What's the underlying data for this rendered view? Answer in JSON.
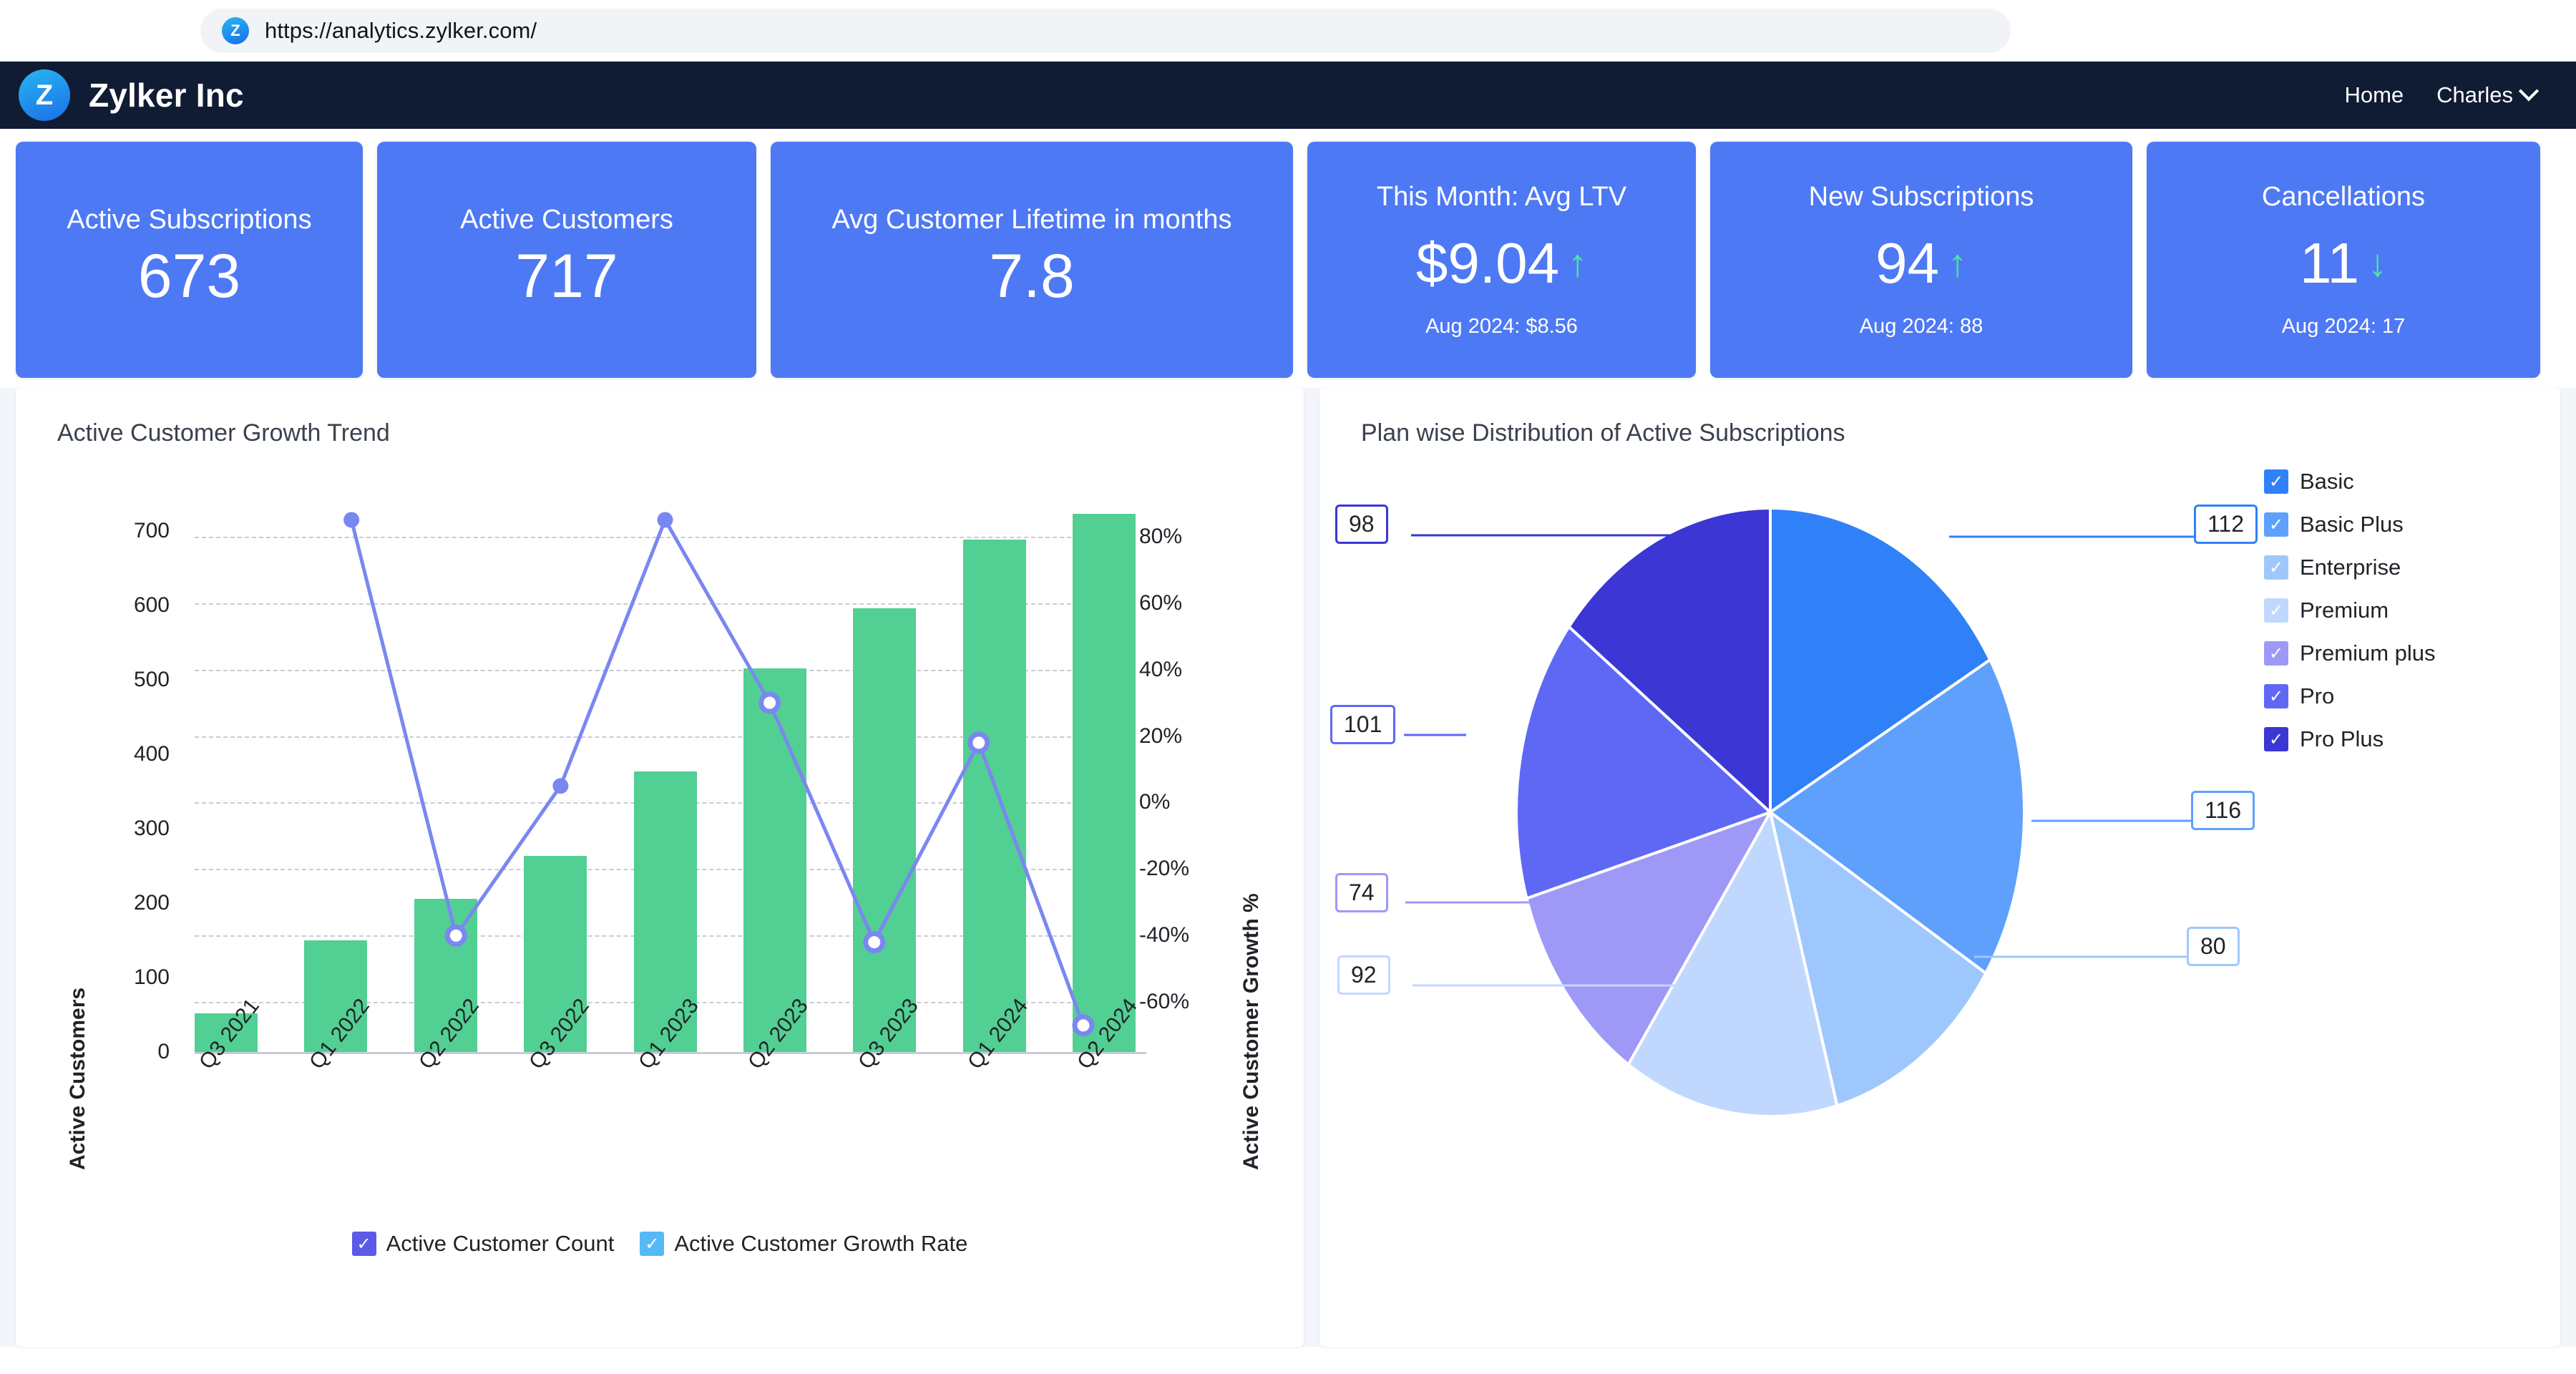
{
  "browser": {
    "url": "https://analytics.zylker.com/",
    "favicon_letter": "Z",
    "favicon_name": "zylker-favicon"
  },
  "header": {
    "logo_letter": "Z",
    "brand": "Zylker Inc",
    "nav": [
      {
        "label": "Home",
        "name": "nav-home"
      },
      {
        "label": "Charles",
        "name": "nav-user"
      }
    ]
  },
  "kpis": [
    {
      "label": "Active Subscriptions",
      "value": "673",
      "sub": "",
      "trend": ""
    },
    {
      "label": "Active Customers",
      "value": "717",
      "sub": "",
      "trend": ""
    },
    {
      "label": "Avg Customer Lifetime in months",
      "value": "7.8",
      "sub": "",
      "trend": ""
    },
    {
      "label": "This Month: Avg LTV",
      "value": "$9.04",
      "sub": "Aug 2024: $8.56",
      "trend": "up"
    },
    {
      "label": "New Subscriptions",
      "value": "94",
      "sub": "Aug 2024: 88",
      "trend": "up"
    },
    {
      "label": "Cancellations",
      "value": "11",
      "sub": "Aug 2024: 17",
      "trend": "down"
    }
  ],
  "kpi_trend_glyphs": {
    "up": "↑",
    "down": "↓",
    "color": "#4ce6a0"
  },
  "panels": {
    "left_title": "Active Customer Growth Trend",
    "right_title": "Plan wise Distribution of Active Subscriptions"
  },
  "chart_data": [
    {
      "type": "bar",
      "title": "Active Customer Growth Trend",
      "xlabel": "",
      "ylabel": "Active Customers",
      "y2label": "Active Customer Growth %",
      "categories": [
        "Q3 2021",
        "Q1 2022",
        "Q2 2022",
        "Q3 2022",
        "Q1 2023",
        "Q2 2023",
        "Q3 2023",
        "Q1 2024",
        "Q2 2024"
      ],
      "ylim": [
        0,
        760
      ],
      "yticks": [
        0,
        100,
        200,
        300,
        400,
        500,
        600,
        700
      ],
      "ytick_labels": [
        "0",
        "100",
        "200",
        "300",
        "400",
        "500",
        "600",
        "700"
      ],
      "y2lim": [
        -75,
        95
      ],
      "y2ticks": [
        -60,
        -40,
        -20,
        0,
        20,
        40,
        60,
        80
      ],
      "y2tick_labels": [
        "-60%",
        "-40%",
        "-20%",
        "0%",
        "20%",
        "40%",
        "60%",
        "80%"
      ],
      "grid": true,
      "legend_position": "bottom",
      "series": [
        {
          "name": "Active Customer Count",
          "kind": "bar",
          "axis": "left",
          "color": "#52cf92",
          "legend_color": "#5b5be8",
          "values": [
            52,
            150,
            206,
            264,
            377,
            516,
            596,
            689,
            723
          ]
        },
        {
          "name": "Active Customer Growth Rate",
          "kind": "line",
          "axis": "right",
          "color": "#7b87f0",
          "legend_color": "#56b9f5",
          "values": [
            null,
            85,
            -40,
            5,
            85,
            30,
            -42,
            18,
            -67
          ]
        }
      ]
    },
    {
      "type": "pie",
      "title": "Plan wise Distribution of Active Subscriptions",
      "legend_position": "right",
      "labels": [
        "Basic",
        "Basic Plus",
        "Enterprise",
        "Premium",
        "Premium plus",
        "Pro",
        "Pro Plus"
      ],
      "values": [
        112,
        116,
        80,
        92,
        74,
        101,
        98
      ],
      "colors": [
        "#3081f7",
        "#5fa0fc",
        "#9ec8fd",
        "#c1d8fe",
        "#9e99f7",
        "#5f68f5",
        "#3b36d4"
      ],
      "total": 673
    }
  ]
}
